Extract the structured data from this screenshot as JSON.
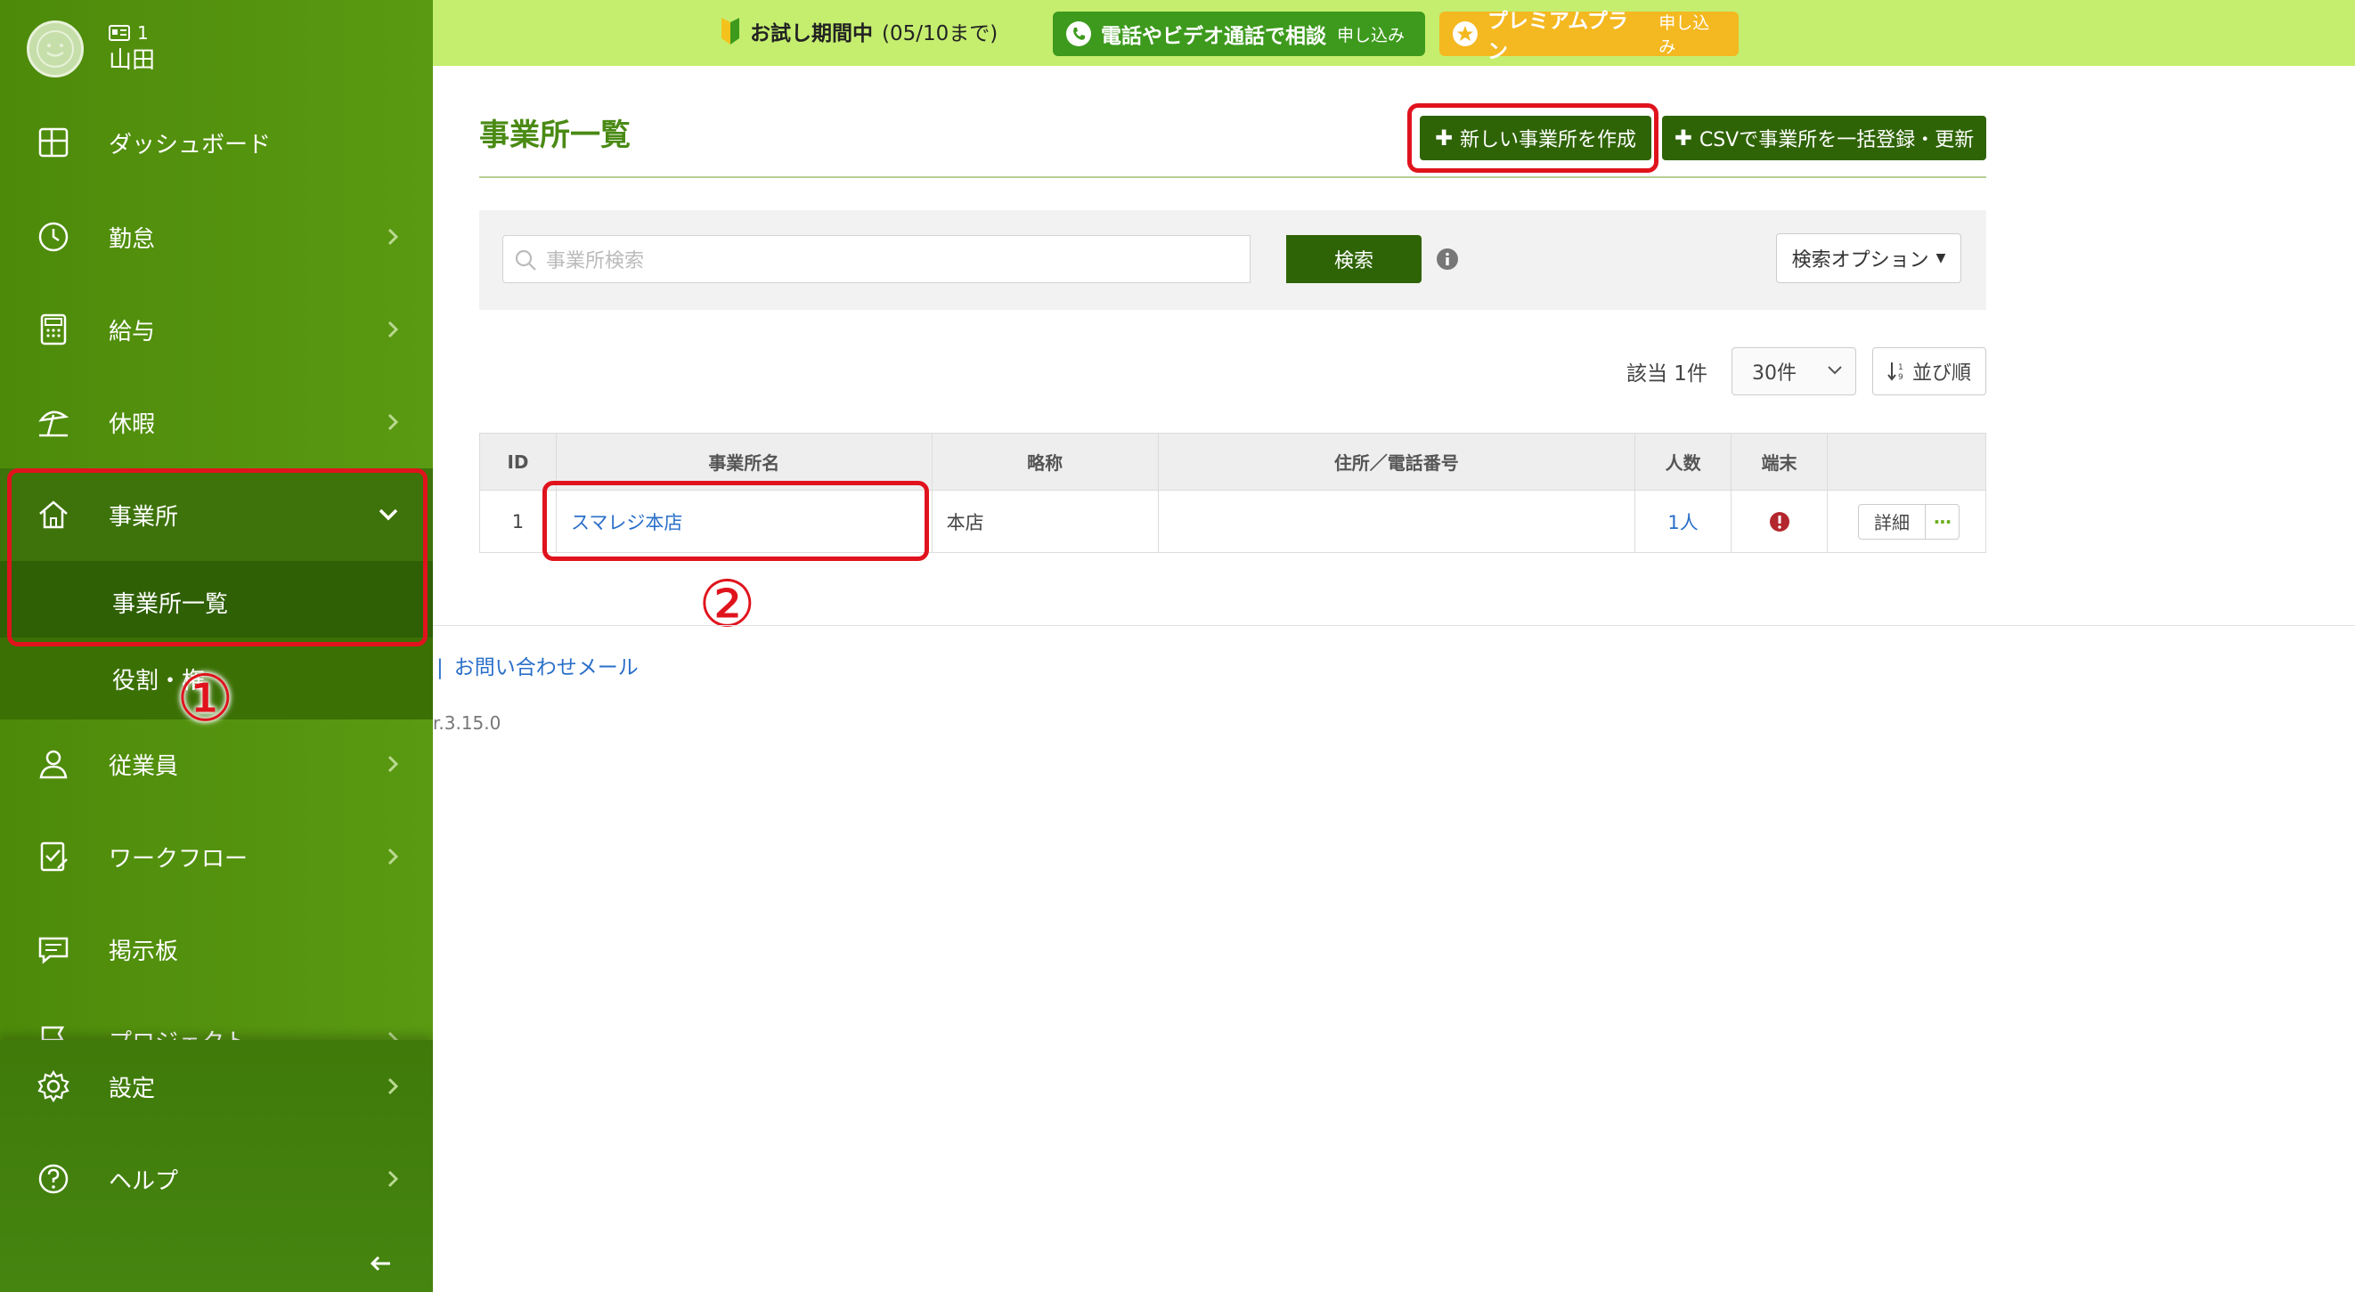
{
  "user": {
    "id": "1",
    "name": "山田"
  },
  "sidebar": {
    "items": [
      {
        "label": "ダッシュボード"
      },
      {
        "label": "勤怠"
      },
      {
        "label": "給与"
      },
      {
        "label": "休暇"
      },
      {
        "label": "事業所"
      },
      {
        "label": "従業員"
      },
      {
        "label": "ワークフロー"
      },
      {
        "label": "掲示板"
      },
      {
        "label": "プロジェクト"
      }
    ],
    "sub_items": [
      {
        "label": "事業所一覧"
      },
      {
        "label": "役割・権"
      }
    ],
    "bottom": [
      {
        "label": "設定"
      },
      {
        "label": "ヘルプ"
      }
    ]
  },
  "topbar": {
    "trial_label": "お試し期間中",
    "trial_period": "(05/10まで)",
    "call_label": "電話やビデオ通話で相談",
    "call_sub": "申し込み",
    "premium_label": "プレミアムプラン",
    "premium_sub": "申し込み"
  },
  "page": {
    "title": "事業所一覧",
    "create_button": "新しい事業所を作成",
    "csv_button": "CSVで事業所を一括登録・更新",
    "search_placeholder": "事業所検索",
    "search_button": "検索",
    "search_options": "検索オプション",
    "count_label": "該当 1件",
    "per_page": "30件",
    "sort_label": "並び順"
  },
  "table": {
    "headers": [
      "ID",
      "事業所名",
      "略称",
      "住所／電話番号",
      "人数",
      "端末",
      ""
    ],
    "rows": [
      {
        "id": "1",
        "name": "スマレジ本店",
        "abbr": "本店",
        "address": "",
        "people": "1人",
        "detail": "詳細",
        "more": "···"
      }
    ]
  },
  "footer": {
    "contact": "お問い合わせメール",
    "version": "r.3.15.0"
  },
  "annotations": {
    "marker1": "①",
    "marker2": "②"
  },
  "colors": {
    "sidebar": "#5a9a12",
    "topbar": "#c5ee6f",
    "accent_dark": "#2f6406",
    "link": "#2a6fc9",
    "highlight": "#e0131d"
  }
}
